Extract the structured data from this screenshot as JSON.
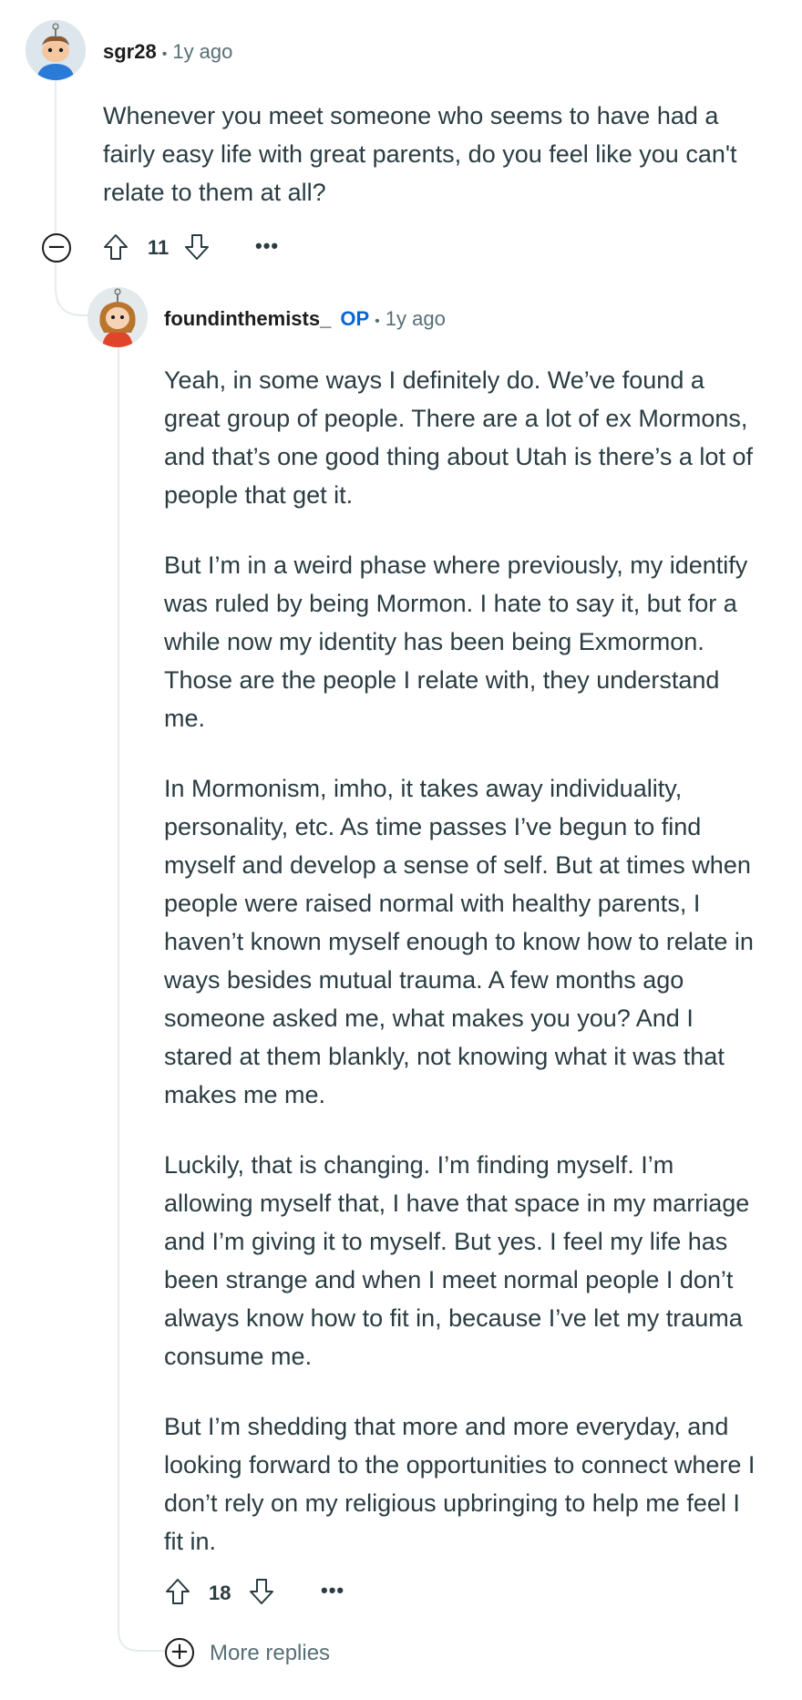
{
  "comments": [
    {
      "username": "sgr28",
      "time": "1y ago",
      "body": [
        "Whenever you meet someone who seems to have had a fairly easy life with great parents, do you feel like you can't relate to them at all?"
      ],
      "votes": "11",
      "avatar_icon": "snoo-avatar-blue-icon"
    },
    {
      "username": "foundinthemists_",
      "badge": "OP",
      "time": "1y ago",
      "body": [
        "Yeah, in some ways I definitely do. We’ve found a great group of people. There are a lot of ex Mormons, and that’s one good thing about Utah is there’s a lot of people that get it.",
        "But I’m in a weird phase where previously, my identify was ruled by being Mormon. I hate to say it, but for a while now my identity has been being Exmormon. Those are the people I relate with, they understand me.",
        "In Mormonism, imho, it takes away individuality, personality, etc. As time passes I’ve begun to find myself and develop a sense of self. But at times when people were raised normal with healthy parents, I haven’t known myself enough to know how to relate in ways besides mutual trauma. A few months ago someone asked me, what makes you you? And I stared at them blankly, not knowing what it was that makes me me.",
        "Luckily, that is changing. I’m finding myself. I’m allowing myself that, I have that space in my marriage and I’m giving it to myself. But yes. I feel my life has been strange and when I meet normal people I don’t always know how to fit in, because I’ve let my trauma consume me.",
        "But I’m shedding that more and more everyday, and looking forward to the opportunities to connect where I don’t rely on my religious upbringing to help me feel I fit in."
      ],
      "votes": "18",
      "avatar_icon": "snoo-avatar-red-hair-icon"
    }
  ],
  "more_label": "•••",
  "collapse_symbol": "−",
  "expand_symbol": "+",
  "more_replies_label": "More replies",
  "separator": "•"
}
